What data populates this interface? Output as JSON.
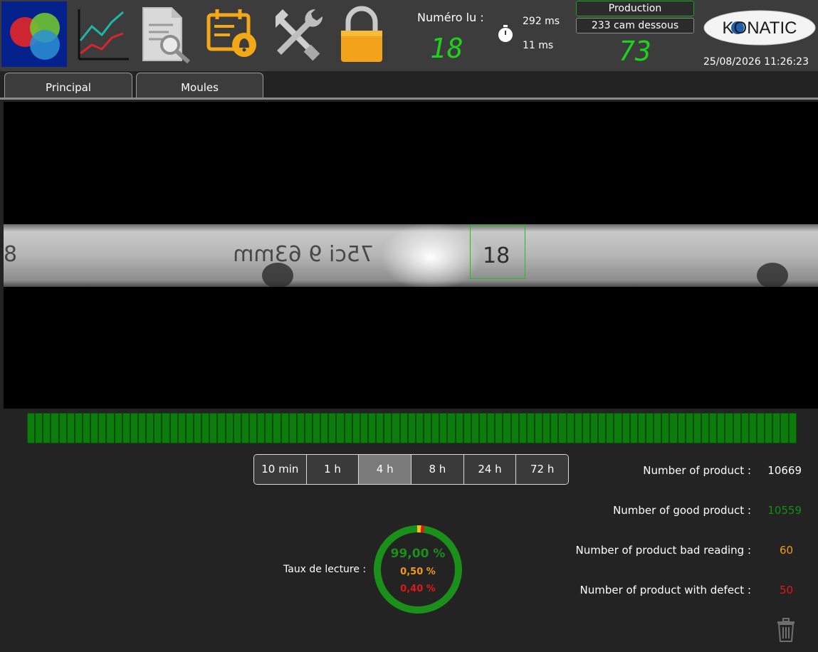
{
  "toolbar": {
    "buttons": [
      {
        "name": "dashboard",
        "icon": "color-circles-icon",
        "active": true
      },
      {
        "name": "statistics",
        "icon": "line-chart-icon"
      },
      {
        "name": "reports",
        "icon": "document-search-icon"
      },
      {
        "name": "alarms",
        "icon": "calendar-bell-icon"
      },
      {
        "name": "settings",
        "icon": "tools-icon"
      },
      {
        "name": "lock",
        "icon": "padlock-icon"
      }
    ],
    "numero_lu_label": "Numéro lu :",
    "numero_lu_value": "18",
    "time_total": "292 ms",
    "time_process": "11 ms",
    "mode_label": "Production",
    "camera_label": "233 cam dessous",
    "counter_value": "73",
    "logo_text": "KONATIC",
    "datetime": "25/08/2026 11:26:23"
  },
  "tabs": [
    {
      "label": "Principal",
      "active": true
    },
    {
      "label": "Moules",
      "active": false
    }
  ],
  "camera": {
    "roi_text": "18"
  },
  "history": {
    "cell_count": 97,
    "color": "#0c7c0c"
  },
  "periods": {
    "options": [
      "10 min",
      "1 h",
      "4 h",
      "8 h",
      "24 h",
      "72 h"
    ],
    "selected": "4 h"
  },
  "reading_rate": {
    "label": "Taux de lecture :",
    "good_percent": "99,00 %",
    "bad_reading_percent": "0,50 %",
    "defect_percent": "0,40 %",
    "good_fraction": 0.99,
    "bad_fraction": 0.005,
    "defect_fraction": 0.004,
    "colors": {
      "good": "#1a8f1a",
      "bad": "#f3c21a",
      "defect": "#e01818"
    }
  },
  "stats": {
    "total_label": "Number of product :",
    "total_value": "10669",
    "good_label": "Number of good product :",
    "good_value": "10559",
    "bad_label": "Number of product bad reading :",
    "bad_value": "60",
    "defect_label": "Number of product with defect :",
    "defect_value": "50"
  },
  "trash_icon": "trash-icon"
}
